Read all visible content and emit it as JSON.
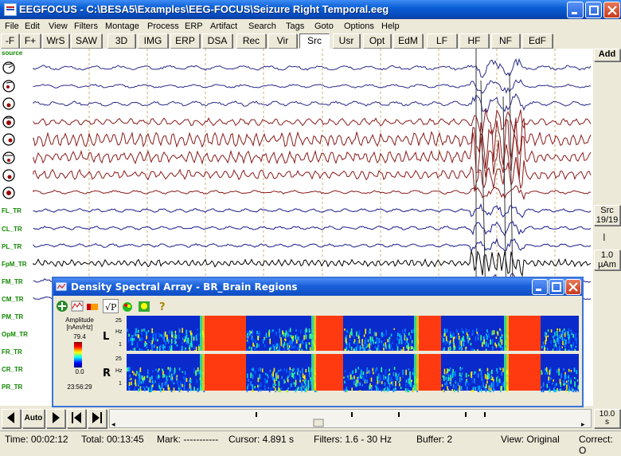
{
  "window": {
    "title": "EEGFOCUS - C:\\BESA5\\Examples\\EEG-FOCUS\\Seizure Right Temporal.eeg"
  },
  "menu": [
    "File",
    "Edit",
    "View",
    "Filters",
    "Montage",
    "Process",
    "ERP",
    "Artifact",
    "Search",
    "Tags",
    "Goto",
    "Options",
    "Help"
  ],
  "toolbar": [
    "-F",
    "F+",
    "WrS",
    "SAW",
    "3D",
    "IMG",
    "ERP",
    "DSA",
    "Rec",
    "Vir",
    "Src",
    "Usr",
    "Opt",
    "EdM",
    "LF",
    "HF",
    "NF",
    "EdF"
  ],
  "channels": {
    "header": "source",
    "labels": [
      "FL_TR",
      "CL_TR",
      "PL_TR",
      "FpM_TR",
      "FM_TR",
      "CM_TR",
      "PM_TR",
      "OpM_TR",
      "FR_TR",
      "CR_TR",
      "PR_TR"
    ]
  },
  "right_panel": {
    "add": "Add",
    "src_line1": "Src",
    "src_line2": "19/19",
    "scale_line1": "1.0",
    "scale_line2": "µAm",
    "page_len": "10.0",
    "page_unit": "s"
  },
  "dsa": {
    "title": "Density Spectral Array - BR_Brain Regions",
    "amplitude_label": "Amplitude",
    "amplitude_unit": "[nAm/Hz]",
    "max_value": "79.4",
    "min_value": "0.0",
    "time": "23:56:29",
    "left_label": "L",
    "right_label": "R",
    "hz_top": "25",
    "hz_label": "Hz",
    "hz_bottom": "1"
  },
  "nav": {
    "auto": "Auto"
  },
  "status": {
    "time": "Time: 00:02:12",
    "total": "Total: 00:13:45",
    "mark": "Mark: -----------",
    "cursor": "Cursor: 4.891 s",
    "filters": "Filters: 1.6 - 30 Hz",
    "buffer": "Buffer: 2",
    "view": "View: Original",
    "correct": "Correct: O"
  }
}
